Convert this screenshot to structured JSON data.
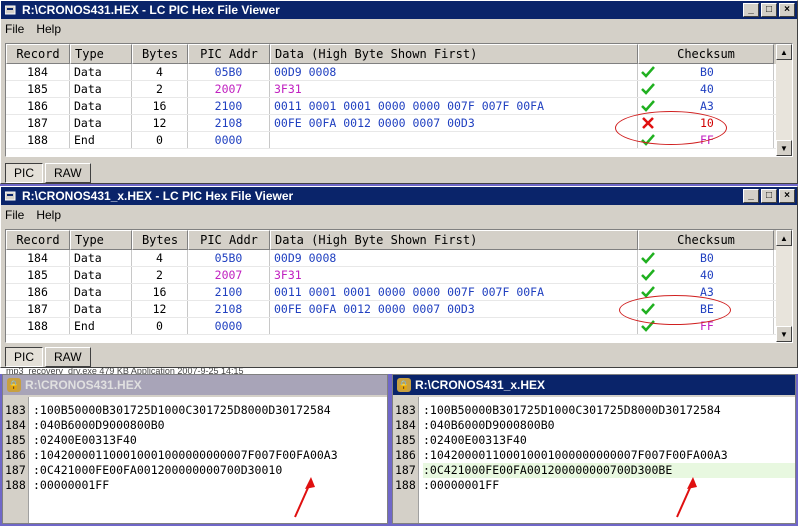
{
  "window1": {
    "title": "R:\\CRONOS431.HEX - LC PIC Hex File Viewer",
    "menu": [
      "File",
      "Help"
    ],
    "columns": [
      "Record",
      "Type",
      "Bytes",
      "PIC Addr",
      "Data (High Byte Shown First)",
      "Checksum"
    ],
    "rows": [
      {
        "record": "184",
        "type": "Data",
        "bytes": "4",
        "addr": "05B0",
        "data": "00D9 0008",
        "status": "ok",
        "checksum": "B0"
      },
      {
        "record": "185",
        "type": "Data",
        "bytes": "2",
        "addr": "2007",
        "data": "3F31",
        "status": "ok",
        "checksum": "40"
      },
      {
        "record": "186",
        "type": "Data",
        "bytes": "16",
        "addr": "2100",
        "data": "0011 0001 0001 0000 0000 007F 007F 00FA",
        "status": "ok",
        "checksum": "A3"
      },
      {
        "record": "187",
        "type": "Data",
        "bytes": "12",
        "addr": "2108",
        "data": "00FE 00FA 0012 0000 0007 00D3",
        "status": "error",
        "checksum": "10"
      },
      {
        "record": "188",
        "type": "End",
        "bytes": "0",
        "addr": "0000",
        "data": "",
        "status": "ok",
        "checksum": "FF"
      }
    ],
    "tabs": [
      "PIC",
      "RAW"
    ]
  },
  "window2": {
    "title": "R:\\CRONOS431_x.HEX - LC PIC Hex File Viewer",
    "menu": [
      "File",
      "Help"
    ],
    "columns": [
      "Record",
      "Type",
      "Bytes",
      "PIC Addr",
      "Data (High Byte Shown First)",
      "Checksum"
    ],
    "rows": [
      {
        "record": "184",
        "type": "Data",
        "bytes": "4",
        "addr": "05B0",
        "data": "00D9 0008",
        "status": "ok",
        "checksum": "B0"
      },
      {
        "record": "185",
        "type": "Data",
        "bytes": "2",
        "addr": "2007",
        "data": "3F31",
        "status": "ok",
        "checksum": "40"
      },
      {
        "record": "186",
        "type": "Data",
        "bytes": "16",
        "addr": "2100",
        "data": "0011 0001 0001 0000 0000 007F 007F 00FA",
        "status": "ok",
        "checksum": "A3"
      },
      {
        "record": "187",
        "type": "Data",
        "bytes": "12",
        "addr": "2108",
        "data": "00FE 00FA 0012 0000 0007 00D3",
        "status": "ok",
        "checksum": "BE"
      },
      {
        "record": "188",
        "type": "End",
        "bytes": "0",
        "addr": "0000",
        "data": "",
        "status": "ok",
        "checksum": "FF"
      }
    ],
    "tabs": [
      "PIC",
      "RAW"
    ]
  },
  "background_strip": "mp3_recovery_drv.exe          479 KB   Application          2007-9-25 14:15",
  "hex1": {
    "title": "R:\\CRONOS431.HEX",
    "line_numbers": [
      "183",
      "184",
      "185",
      "186",
      "187",
      "188"
    ],
    "lines": [
      ":100B50000B301725D1000C301725D8000D30172584",
      ":040B6000D9000800B0",
      ":02400E00313F40",
      ":104200001100010001000000000007F007F00FA00A3",
      ":0C421000FE00FA001200000000700D30010",
      ":00000001FF"
    ]
  },
  "hex2": {
    "title": "R:\\CRONOS431_x.HEX",
    "line_numbers": [
      "183",
      "184",
      "185",
      "186",
      "187",
      "188"
    ],
    "lines": [
      ":100B50000B301725D1000C301725D8000D30172584",
      ":040B6000D9000800B0",
      ":02400E00313F40",
      ":104200001100010001000000000007F007F00FA00A3",
      ":0C421000FE00FA001200000000700D300BE",
      ":00000001FF"
    ]
  },
  "colors": {
    "title_active": "#0a246a",
    "data_blue": "#2040c0",
    "data_magenta": "#c020c0",
    "annotation_red": "#d02020",
    "ok_green": "#20b020"
  }
}
